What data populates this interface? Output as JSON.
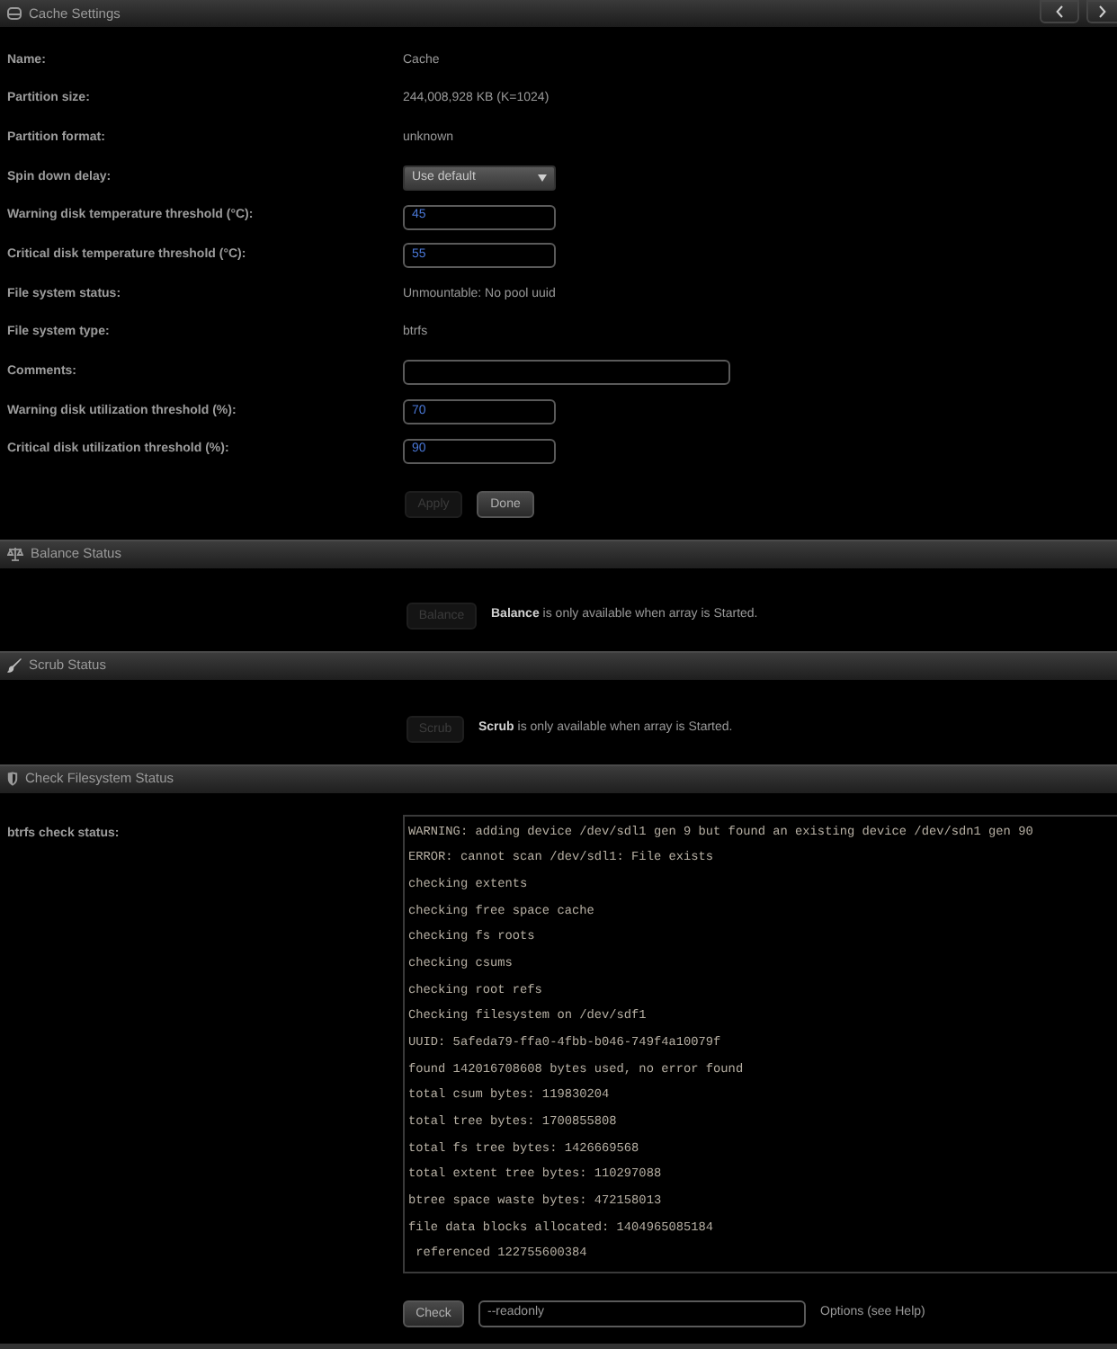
{
  "title_bar": {
    "title": "Cache Settings"
  },
  "settings": {
    "rows": [
      {
        "kind": "text",
        "label": "Name:",
        "value": "Cache"
      },
      {
        "kind": "text",
        "label": "Partition size:",
        "value": "244,008,928 KB (K=1024)"
      },
      {
        "kind": "text",
        "label": "Partition format:",
        "value": "unknown"
      },
      {
        "kind": "select",
        "label": "Spin down delay:",
        "value": "Use default"
      },
      {
        "kind": "number",
        "label": "Warning disk temperature threshold (°C):",
        "value": "45"
      },
      {
        "kind": "number",
        "label": "Critical disk temperature threshold (°C):",
        "value": "55"
      },
      {
        "kind": "text",
        "label": "File system status:",
        "value": "Unmountable: No pool uuid"
      },
      {
        "kind": "text",
        "label": "File system type:",
        "value": "btrfs"
      },
      {
        "kind": "comment",
        "label": "Comments:"
      },
      {
        "kind": "number",
        "label": "Warning disk utilization threshold (%):",
        "value": "70"
      },
      {
        "kind": "number",
        "label": "Critical disk utilization threshold (%):",
        "value": "90"
      }
    ],
    "buttons": [
      {
        "label": "Apply",
        "disabled": true
      },
      {
        "label": "Done",
        "disabled": false
      }
    ]
  },
  "balance": {
    "title": "Balance Status",
    "button": {
      "label": "Balance",
      "disabled": true
    },
    "message": "**Balance** is only available when array is Started."
  },
  "scrub": {
    "title": "Scrub Status",
    "button": {
      "label": "Scrub",
      "disabled": true
    },
    "message": "**Scrub** is only available when array is Started."
  },
  "check": {
    "title": "Check Filesystem Status",
    "label": "btrfs check status:",
    "log": [
      "WARNING: adding device /dev/sdl1 gen 9 but found an existing device /dev/sdn1 gen 90",
      "ERROR: cannot scan /dev/sdl1: File exists",
      "checking extents",
      "checking free space cache",
      "checking fs roots",
      "checking csums",
      "checking root refs",
      "Checking filesystem on /dev/sdf1",
      "UUID: 5afeda79-ffa0-4fbb-b046-749f4a10079f",
      "found 142016708608 bytes used, no error found",
      "total csum bytes: 119830204",
      "total tree bytes: 1700855808",
      "total fs tree bytes: 1426669568",
      "total extent tree bytes: 110297088",
      "btree space waste bytes: 472158013",
      "file data blocks allocated: 1404965085184",
      " referenced 122755600384"
    ],
    "button": {
      "label": "Check",
      "disabled": false
    },
    "options": {
      "value": "--readonly"
    },
    "options_hint": "Options (see Help)"
  }
}
